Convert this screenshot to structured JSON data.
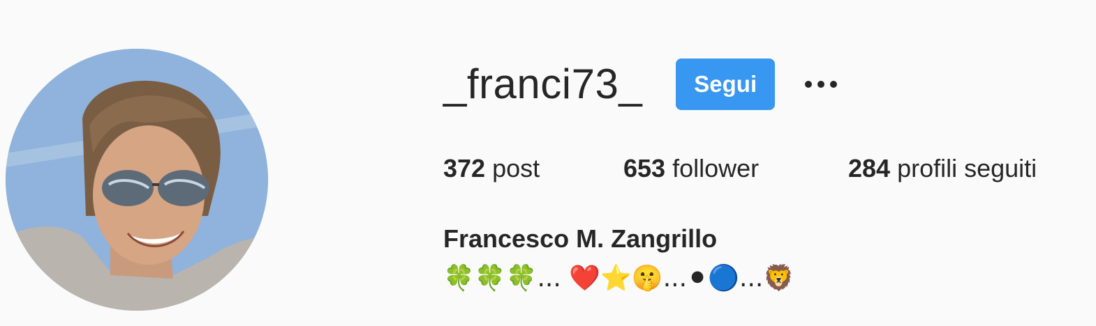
{
  "profile": {
    "username": "_franci73_",
    "follow_label": "Segui",
    "more_icon": "more-horizontal-icon",
    "avatar_alt": "avatar",
    "stats": [
      {
        "count": "372",
        "label": "post"
      },
      {
        "count": "653",
        "label": "follower"
      },
      {
        "count": "284",
        "label": "profili seguiti"
      }
    ],
    "full_name": "Francesco M. Zangrillo",
    "bio": "🍀🍀🍀... ❤️⭐🤫...⚫🔵...🦁"
  },
  "colors": {
    "background": "#fafafa",
    "text": "#262626",
    "follow_button": "#3897f0",
    "follow_button_text": "#ffffff"
  }
}
